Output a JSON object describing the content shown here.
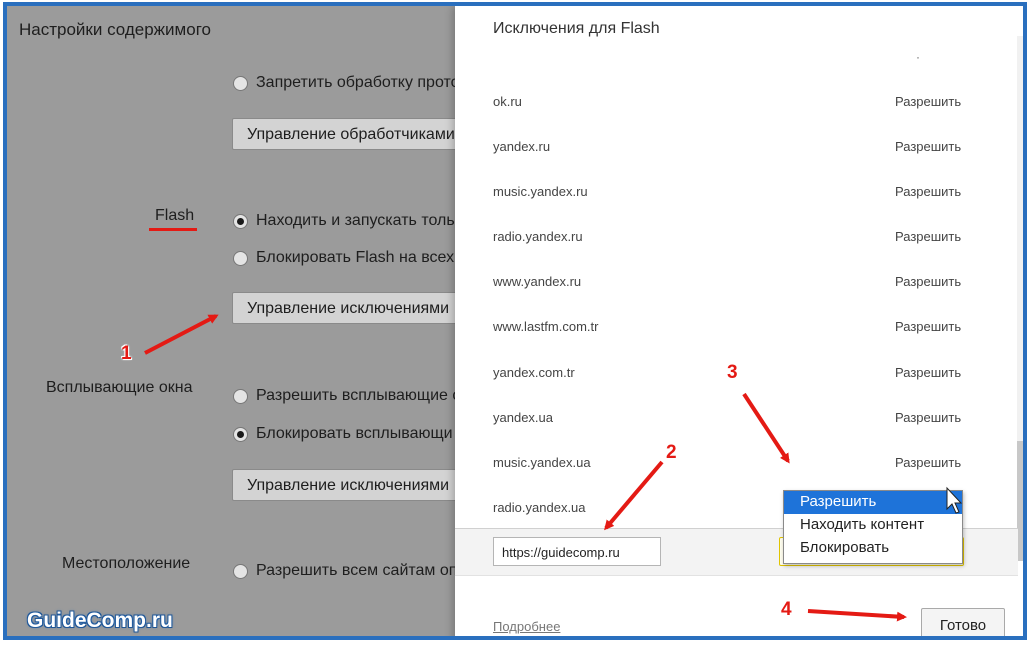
{
  "background": {
    "page_title": "Настройки содержимого",
    "handlers": {
      "radio_block": "Запретить обработку прото",
      "manage_button": "Управление обработчиками"
    },
    "flash": {
      "label": "Flash",
      "option_find_run": "Находить и запускать тольк",
      "option_block": "Блокировать Flash на всех",
      "manage_exceptions": "Управление исключениями",
      "selected_option": "find_run"
    },
    "popups": {
      "label": "Всплывающие окна",
      "option_allow": "Разрешить всплывающие о",
      "option_block": "Блокировать всплывающи",
      "manage_exceptions": "Управление исключениями",
      "selected_option": "block"
    },
    "location": {
      "label": "Местоположение",
      "option_allow_all": "Разрешить всем сайтам оп"
    }
  },
  "dialog": {
    "title": "Исключения для Flash",
    "rows": [
      {
        "site": "ok.ru",
        "action": "Разрешить"
      },
      {
        "site": "yandex.ru",
        "action": "Разрешить"
      },
      {
        "site": "music.yandex.ru",
        "action": "Разрешить"
      },
      {
        "site": "radio.yandex.ru",
        "action": "Разрешить"
      },
      {
        "site": "www.yandex.ru",
        "action": "Разрешить"
      },
      {
        "site": "www.lastfm.com.tr",
        "action": "Разрешить"
      },
      {
        "site": "yandex.com.tr",
        "action": "Разрешить"
      },
      {
        "site": "yandex.ua",
        "action": "Разрешить"
      },
      {
        "site": "music.yandex.ua",
        "action": "Разрешить"
      },
      {
        "site": "radio.yandex.ua",
        "action": ""
      }
    ],
    "new_site_value": "https://guidecomp.ru",
    "behavior_dropdown": {
      "options": [
        "Разрешить",
        "Находить контент",
        "Блокировать"
      ],
      "highlighted": "Разрешить"
    },
    "more_link": "Подробнее",
    "done_button": "Готово"
  },
  "annotations": {
    "step1": "1",
    "step2": "2",
    "step3": "3",
    "step4": "4",
    "arrow_color": "#e41a14"
  },
  "watermark": "GuideComp.ru",
  "colors": {
    "frame_border": "#2a6fbe",
    "dropdown_highlight": "#1e73d9",
    "underline_red": "#e41a14"
  }
}
